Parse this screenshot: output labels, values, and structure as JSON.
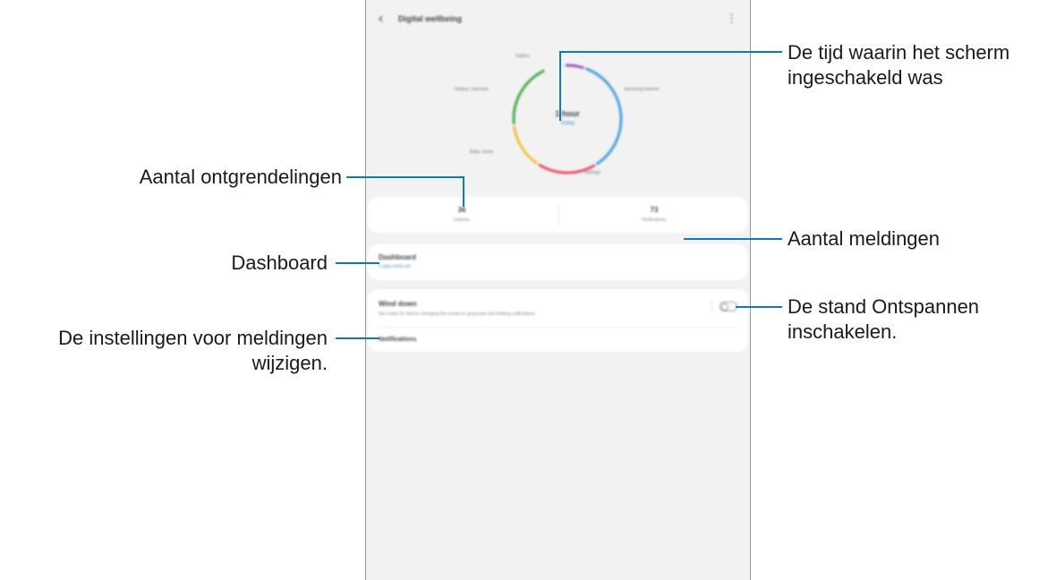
{
  "screen": {
    "app_title": "Digital wellbeing",
    "chart_data": {
      "type": "donut",
      "segments": [
        {
          "label": "Gallery",
          "color": "#9b59b6",
          "fraction": 0.06
        },
        {
          "label": "Samsung Internet",
          "color": "#4aa3df",
          "fraction": 0.36
        },
        {
          "label": "Settings",
          "color": "#e5536a",
          "fraction": 0.18
        },
        {
          "label": "Baby Jones",
          "color": "#f0c33c",
          "fraction": 0.14
        },
        {
          "label": "Galaxy Launcher",
          "color": "#4caf50",
          "fraction": 0.2
        }
      ],
      "gaps_fraction": 0.06
    },
    "screen_time": {
      "value": "1 hour",
      "sub": "Today"
    },
    "unlocks": {
      "value": "36",
      "label": "Unlocks"
    },
    "notifications": {
      "value": "73",
      "label": "Notifications"
    },
    "dashboard": {
      "title": "Dashboard",
      "sub": "6 apps limits set"
    },
    "wind_down": {
      "title": "Wind down",
      "desc": "Get ready for bed by changing the screen to grayscale and limiting notifications.",
      "enabled": false
    },
    "notifications_setting": "Notifications"
  },
  "callouts": {
    "screen_time": [
      "De tijd waarin het scherm",
      "ingeschakeld was"
    ],
    "unlocks": "Aantal ontgrendelingen",
    "notification_count": "Aantal meldingen",
    "dashboard": "Dashboard",
    "relax_mode": [
      "De stand Ontspannen",
      "inschakelen."
    ],
    "notification_settings": [
      "De instellingen voor meldingen",
      "wijzigen."
    ]
  },
  "colors": {
    "callout_line": "#0b7bbf",
    "link_blue": "#4a90d9"
  }
}
